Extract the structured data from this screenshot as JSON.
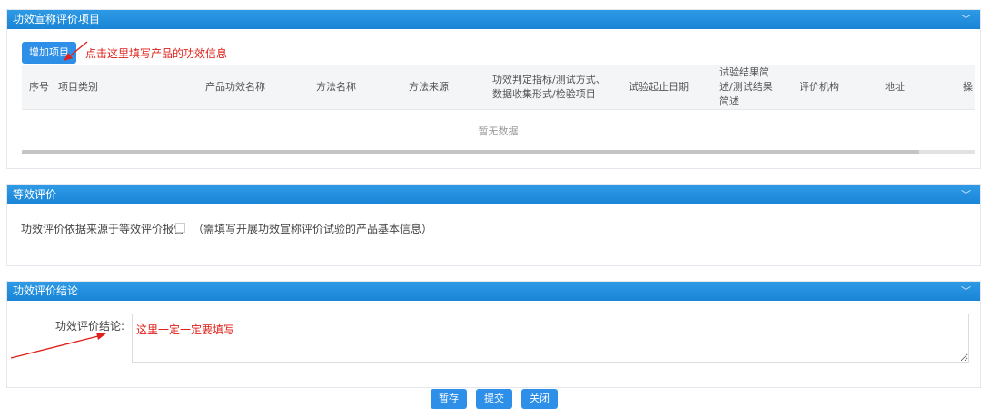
{
  "section1": {
    "title": "功效宣称评价项目",
    "add_button": "增加项目",
    "annotation": "点击这里填写产品的功效信息",
    "columns": [
      "序号",
      "项目类别",
      "产品功效名称",
      "方法名称",
      "方法来源",
      "功效判定指标/测试方式、数据收集形式/检验项目",
      "试验起止日期",
      "试验结果简述/测试结果简述",
      "评价机构",
      "地址",
      "操"
    ],
    "empty_text": "暂无数据"
  },
  "section2": {
    "title": "等效评价",
    "label": "功效评价依据来源于等效评价报告",
    "note": "（需填写开展功效宣称评价试验的产品基本信息）"
  },
  "section3": {
    "title": "功效评价结论",
    "label": "功效评价结论:",
    "value": "这里一定一定要填写"
  },
  "footer": {
    "save": "暂存",
    "submit": "提交",
    "close": "关闭"
  },
  "icons": {
    "collapse": "chevron-down-icon"
  },
  "colors": {
    "header": "#1a84d6",
    "button": "#2e8fe8",
    "annotation": "#e0201a"
  }
}
